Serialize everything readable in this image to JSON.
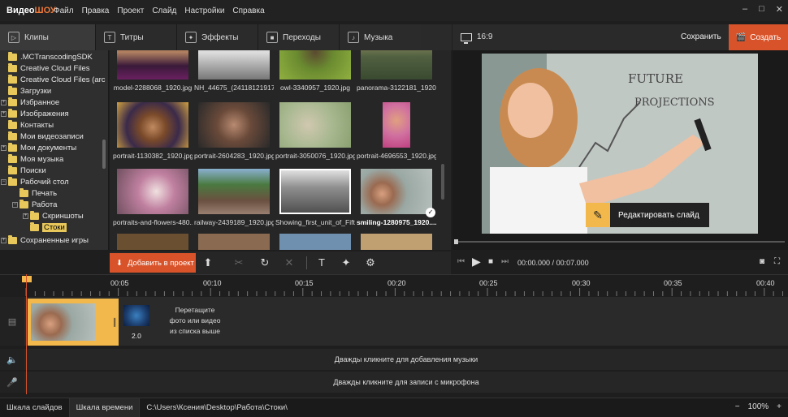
{
  "app": {
    "logo_a": "Видео",
    "logo_b": "ШОУ"
  },
  "menu": [
    "Файл",
    "Правка",
    "Проект",
    "Слайд",
    "Настройки",
    "Справка"
  ],
  "tabs": [
    {
      "label": "Клипы",
      "icon": "play-icon"
    },
    {
      "label": "Титры",
      "icon": "text-icon"
    },
    {
      "label": "Эффекты",
      "icon": "magic-wand-icon"
    },
    {
      "label": "Переходы",
      "icon": "transition-icon"
    },
    {
      "label": "Музыка",
      "icon": "music-icon"
    }
  ],
  "tree": [
    {
      "label": ".MCTranscodingSDK",
      "level": 0
    },
    {
      "label": "Creative Cloud Files",
      "level": 0
    },
    {
      "label": "Creative Cloud Files (arc",
      "level": 0
    },
    {
      "label": "Загрузки",
      "level": 0
    },
    {
      "label": "Избранное",
      "level": 0,
      "expander": "+"
    },
    {
      "label": "Изображения",
      "level": 0,
      "expander": "+"
    },
    {
      "label": "Контакты",
      "level": 0
    },
    {
      "label": "Мои видеозаписи",
      "level": 0
    },
    {
      "label": "Мои документы",
      "level": 0,
      "expander": "+"
    },
    {
      "label": "Моя музыка",
      "level": 0
    },
    {
      "label": "Поиски",
      "level": 0
    },
    {
      "label": "Рабочий стол",
      "level": 0,
      "expander": "−"
    },
    {
      "label": "Печать",
      "level": 1
    },
    {
      "label": "Работа",
      "level": 1,
      "expander": "−"
    },
    {
      "label": "Скриншоты",
      "level": 2,
      "expander": "+"
    },
    {
      "label": "Стоки",
      "level": 2,
      "selected": true
    },
    {
      "label": "Сохраненные игры",
      "level": 0,
      "expander": "+"
    }
  ],
  "thumbnails": [
    {
      "caption": "model-2288068_1920.jpg"
    },
    {
      "caption": "NH_44675_(24118121917..."
    },
    {
      "caption": "owl-3340957_1920.jpg"
    },
    {
      "caption": "panorama-3122181_1920..."
    },
    {
      "caption": "portrait-1130382_1920.jpg"
    },
    {
      "caption": "portrait-2604283_1920.jpg"
    },
    {
      "caption": "portrait-3050076_1920.jpg"
    },
    {
      "caption": "portrait-4696553_1920.jpg"
    },
    {
      "caption": "portraits-and-flowers-480..."
    },
    {
      "caption": "railway-2439189_1920.jpg"
    },
    {
      "caption": "Showing_first_unit_of_Fift..."
    },
    {
      "caption": "smiling-1280975_1920....",
      "selected": true
    }
  ],
  "preview": {
    "aspect": "16:9",
    "save_label": "Сохранить",
    "create_label": "Создать",
    "edit_slide_label": "Редактировать слайд"
  },
  "toolbar": {
    "add_label": "Добавить в проект"
  },
  "player": {
    "current": "00:00.000",
    "total": "00:07.000"
  },
  "ruler": [
    "00:05",
    "00:10",
    "00:15",
    "00:20",
    "00:25",
    "00:30",
    "00:35",
    "00:40"
  ],
  "timeline": {
    "transition_duration": "2.0",
    "drop_hint_1": "Перетащите",
    "drop_hint_2": "фото или видео",
    "drop_hint_3": "из списка выше",
    "audio_hint": "Дважды кликните для добавления музыки",
    "mic_hint": "Дважды кликните для записи с микрофона"
  },
  "statusbar": {
    "tab_slides": "Шкала слайдов",
    "tab_timeline": "Шкала времени",
    "path": "C:\\Users\\Ксения\\Desktop\\Работа\\Стоки\\",
    "zoom": "100%"
  },
  "colors": {
    "accent": "#d9532a",
    "highlight": "#f2b84b",
    "folder": "#e8c85a"
  }
}
